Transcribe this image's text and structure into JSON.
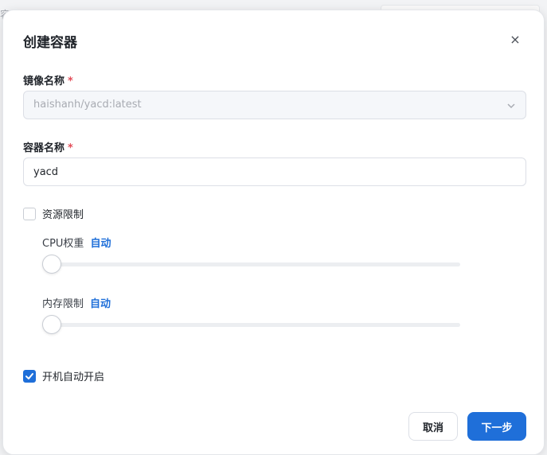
{
  "backdrop": {
    "label": "容器"
  },
  "dialog": {
    "title": "创建容器",
    "close_icon": "×"
  },
  "image_field": {
    "label": "镜像名称",
    "required_mark": "*",
    "value": "haishanh/yacd:latest"
  },
  "name_field": {
    "label": "容器名称",
    "required_mark": "*",
    "value": "yacd"
  },
  "resource_limit": {
    "label": "资源限制",
    "checked": false
  },
  "cpu_weight": {
    "label": "CPU权重",
    "mode": "自动",
    "level": 0
  },
  "memory_limit": {
    "label": "内存限制",
    "mode": "自动",
    "level": 0
  },
  "autostart": {
    "label": "开机自动开启",
    "checked": true
  },
  "footer": {
    "cancel_label": "取消",
    "next_label": "下一步"
  },
  "colors": {
    "accent": "#1f6fd9",
    "required": "#e34d59"
  }
}
